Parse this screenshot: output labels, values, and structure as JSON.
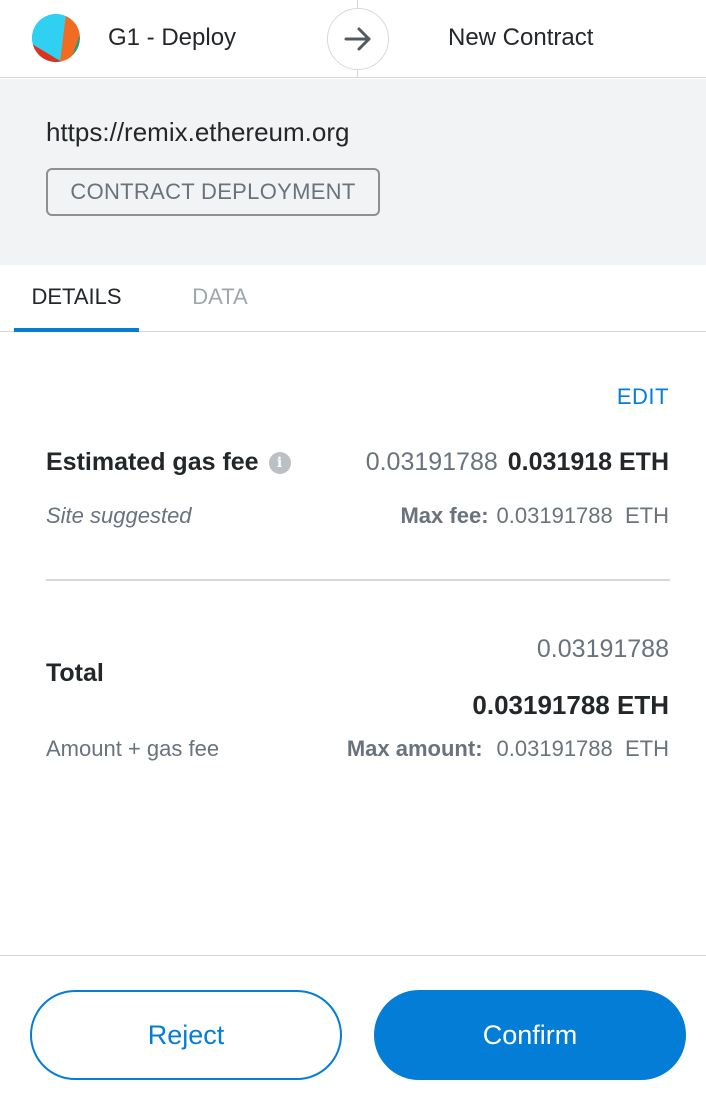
{
  "header": {
    "account_name": "G1 - Deploy",
    "destination": "New Contract"
  },
  "origin": {
    "url": "https://remix.ethereum.org",
    "type_badge": "CONTRACT DEPLOYMENT"
  },
  "tabs": [
    {
      "label": "DETAILS",
      "active": true
    },
    {
      "label": "DATA",
      "active": false
    }
  ],
  "details": {
    "edit_label": "EDIT",
    "gas_fee_label": "Estimated gas fee",
    "gas_fee_secondary": "0.03191788",
    "gas_fee_primary": "0.031918 ETH",
    "site_suggested": "Site suggested",
    "max_fee_label": "Max fee:",
    "max_fee_value": "0.03191788  ETH",
    "total_label": "Total",
    "total_secondary": "0.03191788",
    "total_primary": "0.03191788 ETH",
    "amount_gas_label": "Amount + gas fee",
    "max_amount_label": "Max amount:",
    "max_amount_value": "0.03191788  ETH"
  },
  "footer": {
    "reject_label": "Reject",
    "confirm_label": "Confirm"
  },
  "colors": {
    "accent": "#037dd6",
    "muted": "#6a737d",
    "panel": "#f2f3f4"
  }
}
